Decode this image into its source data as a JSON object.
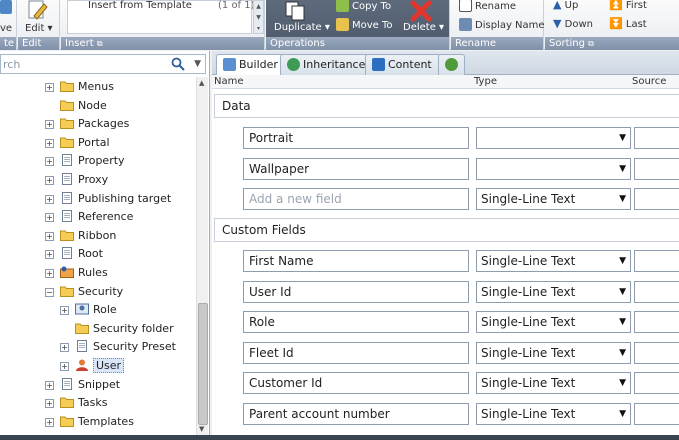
{
  "ribbon": {
    "groups": {
      "first": {
        "partial_label": "ve",
        "bar_label": "te"
      },
      "edit": {
        "button_label": "Edit",
        "bar_label": "Edit"
      },
      "insert": {
        "insert_from_template": "Insert from Template",
        "page_count": "(1 of 1)",
        "bar_label": "Insert"
      },
      "operations": {
        "duplicate": "Duplicate",
        "copy_to": "Copy To",
        "move_to": "Move To",
        "delete": "Delete",
        "bar_label": "Operations"
      },
      "rename": {
        "rename": "Rename",
        "display_name": "Display Name",
        "bar_label": "Rename"
      },
      "sorting": {
        "up": "Up",
        "down": "Down",
        "first": "First",
        "last": "Last",
        "bar_label": "Sorting"
      }
    }
  },
  "search": {
    "placeholder": "rch"
  },
  "tree": {
    "items": [
      {
        "label": "Menus",
        "icon": "folder",
        "expander": "+",
        "indent": 0
      },
      {
        "label": "Node",
        "icon": "folder",
        "expander": "",
        "indent": 0
      },
      {
        "label": "Packages",
        "icon": "folder",
        "expander": "+",
        "indent": 0
      },
      {
        "label": "Portal",
        "icon": "folder",
        "expander": "+",
        "indent": 0
      },
      {
        "label": "Property",
        "icon": "page",
        "expander": "+",
        "indent": 0
      },
      {
        "label": "Proxy",
        "icon": "page",
        "expander": "+",
        "indent": 0
      },
      {
        "label": "Publishing target",
        "icon": "page",
        "expander": "+",
        "indent": 0
      },
      {
        "label": "Reference",
        "icon": "page",
        "expander": "+",
        "indent": 0
      },
      {
        "label": "Ribbon",
        "icon": "folder",
        "expander": "+",
        "indent": 0
      },
      {
        "label": "Root",
        "icon": "page",
        "expander": "+",
        "indent": 0
      },
      {
        "label": "Rules",
        "icon": "rules",
        "expander": "+",
        "indent": 0
      },
      {
        "label": "Security",
        "icon": "folder",
        "expander": "−",
        "indent": 0
      },
      {
        "label": "Role",
        "icon": "role",
        "expander": "+",
        "indent": 1
      },
      {
        "label": "Security folder",
        "icon": "folder",
        "expander": "",
        "indent": 1
      },
      {
        "label": "Security Preset",
        "icon": "page",
        "expander": "+",
        "indent": 1
      },
      {
        "label": "User",
        "icon": "user",
        "expander": "+",
        "indent": 1,
        "selected": true
      },
      {
        "label": "Snippet",
        "icon": "page",
        "expander": "+",
        "indent": 0
      },
      {
        "label": "Tasks",
        "icon": "folder",
        "expander": "+",
        "indent": 0
      },
      {
        "label": "Templates",
        "icon": "folder",
        "expander": "+",
        "indent": 0
      }
    ]
  },
  "tabs": [
    {
      "label": "Builder",
      "icon": "builder-icon",
      "active": true
    },
    {
      "label": "Inheritance",
      "icon": "inheritance-icon",
      "active": false
    },
    {
      "label": "Content",
      "icon": "content-icon",
      "active": false
    },
    {
      "label": "",
      "icon": "globe-icon",
      "active": false
    }
  ],
  "columns": {
    "name": "Name",
    "type": "Type",
    "source": "Source"
  },
  "sections": {
    "data": {
      "title": "Data",
      "fields": [
        {
          "name": "Portrait",
          "type": ""
        },
        {
          "name": "Wallpaper",
          "type": ""
        }
      ],
      "new_field": {
        "placeholder": "Add a new field",
        "type": "Single-Line Text"
      }
    },
    "custom": {
      "title": "Custom Fields",
      "fields": [
        {
          "name": "First Name",
          "type": "Single-Line Text"
        },
        {
          "name": "User Id",
          "type": "Single-Line Text"
        },
        {
          "name": "Role",
          "type": "Single-Line Text"
        },
        {
          "name": "Fleet Id",
          "type": "Single-Line Text"
        },
        {
          "name": "Customer Id",
          "type": "Single-Line Text"
        },
        {
          "name": "Parent account number",
          "type": "Single-Line Text"
        }
      ]
    }
  }
}
